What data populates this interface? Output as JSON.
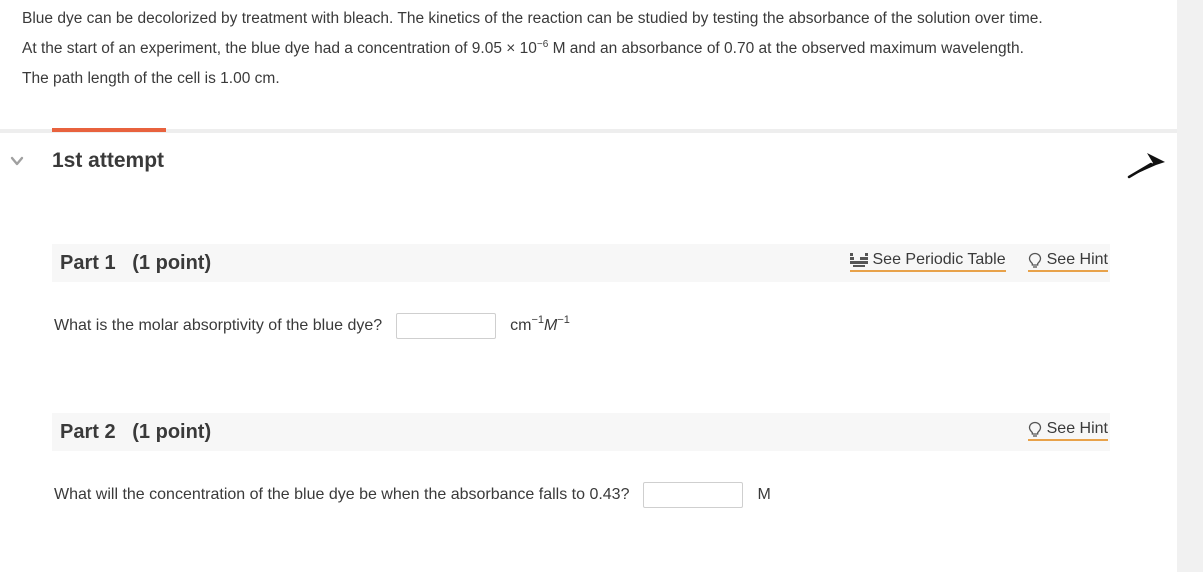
{
  "intro": {
    "line1": "Blue dye can be decolorized by treatment with bleach. The kinetics of the reaction can be studied by testing the absorbance of the solution over time.",
    "line2_a": "At the start of an experiment, the blue dye had a concentration of 9.05 × 10",
    "line2_exp": "−6",
    "line2_b": " M and an absorbance of 0.70 at the observed maximum wavelength.",
    "line3": "The path length of the cell is 1.00 cm."
  },
  "attempt": {
    "title": "1st attempt"
  },
  "parts": [
    {
      "title": "Part 1   (1 point)",
      "periodic_link": "See Periodic Table",
      "hint_link": "See Hint",
      "question": "What is the molar absorptivity of the blue dye?",
      "input_value": "",
      "unit_cm": "cm",
      "unit_cm_exp": "−1",
      "unit_m": "M",
      "unit_m_exp": "−1"
    },
    {
      "title": "Part 2   (1 point)",
      "hint_link": "See Hint",
      "question": "What will the concentration of the blue dye be when the absorbance falls to 0.43?",
      "input_value": "",
      "unit": "M"
    }
  ],
  "colors": {
    "accent": "#e8623e",
    "link_underline": "#e8a24a",
    "part_bar": "#f7f7f7"
  },
  "icons": [
    "chevron-down-icon",
    "cursor-arrow-icon",
    "periodic-table-icon",
    "lightbulb-icon"
  ]
}
